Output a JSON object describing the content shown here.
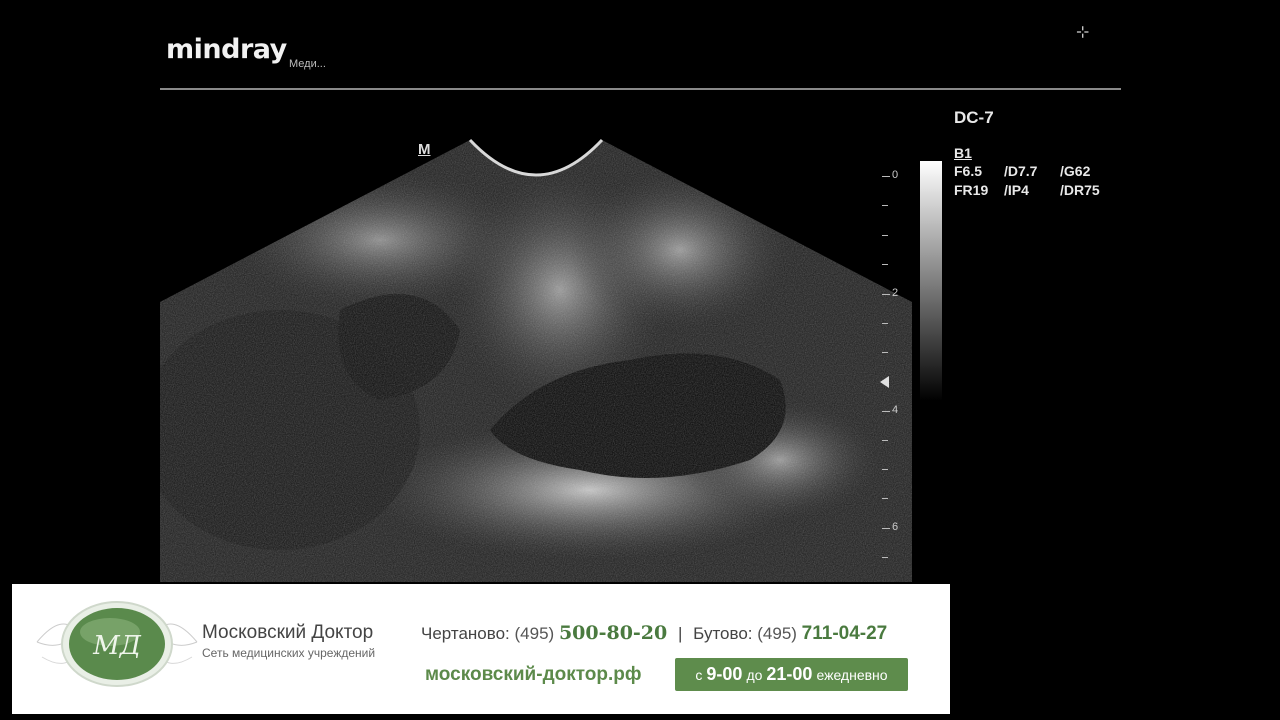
{
  "header": {
    "brand": "mindray",
    "brand_sub": "Меди...",
    "corner_icon": "crosshair-icon"
  },
  "image": {
    "orientation_marker": "M",
    "depth_labels": [
      "0",
      "2",
      "4",
      "6"
    ]
  },
  "side_panel": {
    "device": "DC-7",
    "mode": "B1",
    "params_row1": [
      "F6.5",
      "/D7.7",
      "/G62"
    ],
    "params_row2": [
      "FR19",
      "/IP4",
      "/DR75"
    ]
  },
  "banner": {
    "clinic_name": "Московский Доктор",
    "clinic_sub": "Сеть медицинских учреждений",
    "phone1_label": "Чертаново:",
    "phone1_code": "(495)",
    "phone1_number": "500-80-20",
    "separator": "|",
    "phone2_label": "Бутово:",
    "phone2_code": "(495)",
    "phone2_number": "711-04-27",
    "website": "московский-доктор.рф",
    "hours_prefix": "с",
    "hours_from": "9-00",
    "hours_mid": "до",
    "hours_to": "21-00",
    "hours_suffix": "ежедневно",
    "emblem_letters": "МД",
    "colors": {
      "accent": "#5e8c4c",
      "text": "#444444"
    }
  }
}
